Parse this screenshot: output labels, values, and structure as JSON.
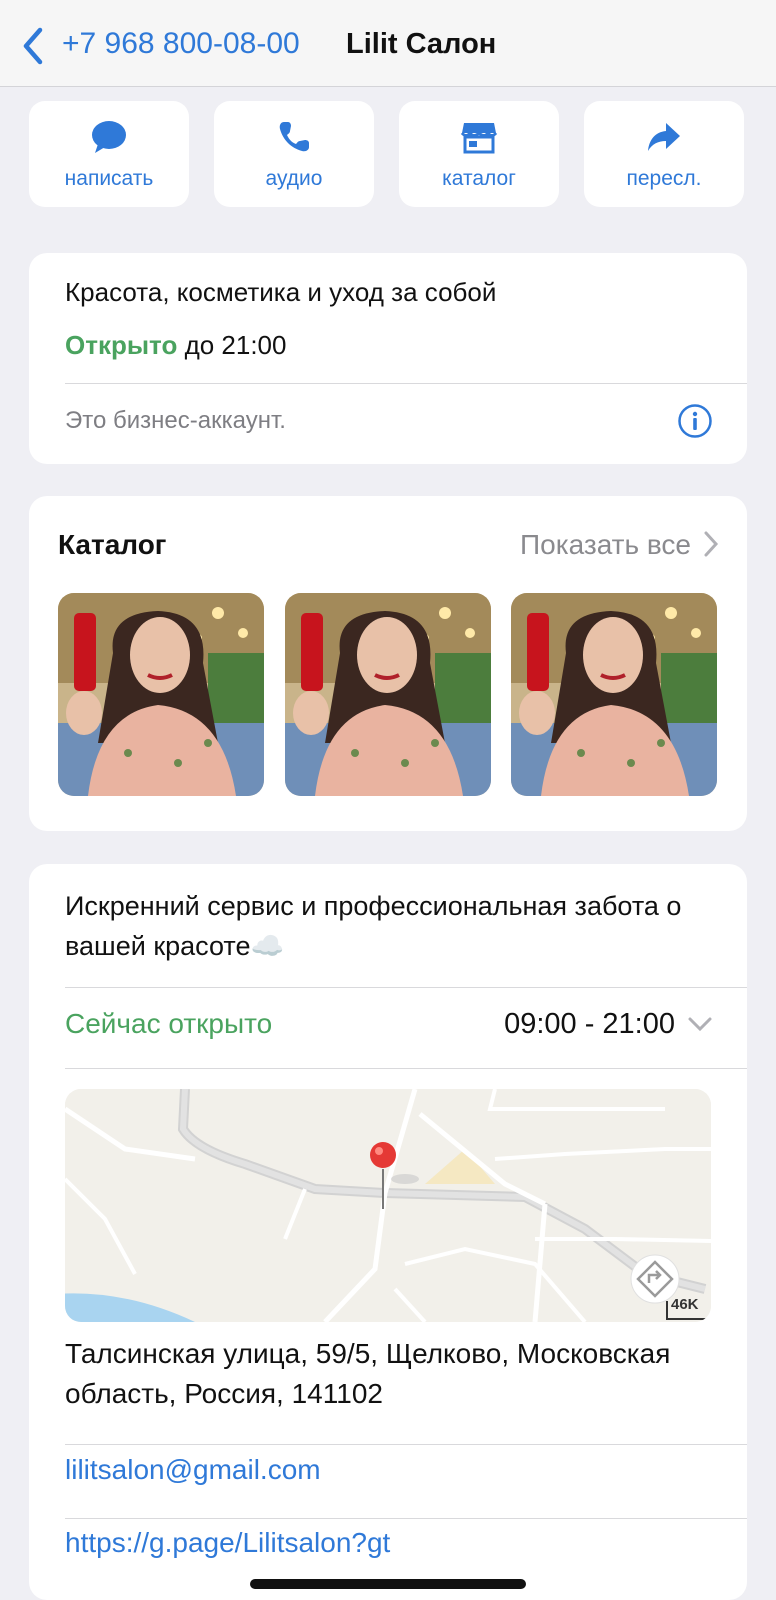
{
  "header": {
    "phone": "+7 968 800-08-00",
    "name": "Lilit Салон"
  },
  "actions": [
    {
      "label": "написать",
      "icon": "chat-bubble-icon"
    },
    {
      "label": "аудио",
      "icon": "phone-icon"
    },
    {
      "label": "каталог",
      "icon": "storefront-icon"
    },
    {
      "label": "пересл.",
      "icon": "share-arrow-icon"
    }
  ],
  "business": {
    "category": "Красота, косметика и уход за собой",
    "open_word": "Открыто",
    "open_until": "до 21:00",
    "note": "Это бизнес-аккаунт."
  },
  "catalog": {
    "title": "Каталог",
    "show_all": "Показать все",
    "items_count": 3
  },
  "details": {
    "description": "Искренний сервис и профессиональная забота о вашей красоте☁️",
    "status": "Сейчас открыто",
    "hours": "09:00 - 21:00",
    "map_scale_label": "46K",
    "address": "Талсинская улица, 59/5, Щелково, Московская область, Россия, 141102",
    "email": "lilitsalon@gmail.com",
    "website": "https://g.page/Lilitsalon?gt"
  },
  "colors": {
    "accent": "#2f79d8",
    "open_green": "#4aa35f",
    "background": "#efeff4"
  }
}
